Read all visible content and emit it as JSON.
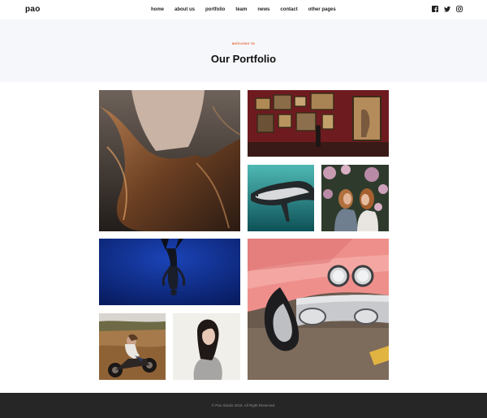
{
  "brand": {
    "logo": "pao"
  },
  "nav": {
    "items": [
      {
        "label": "home"
      },
      {
        "label": "about us"
      },
      {
        "label": "portfolio"
      },
      {
        "label": "team"
      },
      {
        "label": "news"
      },
      {
        "label": "contact"
      },
      {
        "label": "other pages"
      }
    ]
  },
  "social": {
    "icons": [
      "facebook-icon",
      "twitter-icon",
      "instagram-icon"
    ]
  },
  "hero": {
    "kicker": "welcome to",
    "title": "Our Portfolio",
    "kicker_color": "#e3653a"
  },
  "portfolio": {
    "items": [
      {
        "name": "portfolio-item-hair",
        "subject": "woman with long hair"
      },
      {
        "name": "portfolio-item-gallery",
        "subject": "museum gallery red wall"
      },
      {
        "name": "portfolio-item-seal",
        "subject": "seal underwater"
      },
      {
        "name": "portfolio-item-friends",
        "subject": "two women with flowers"
      },
      {
        "name": "portfolio-item-diver",
        "subject": "free diver blue water"
      },
      {
        "name": "portfolio-item-car",
        "subject": "pink vintage car"
      },
      {
        "name": "portfolio-item-motorcycle",
        "subject": "woman on motorcycle"
      },
      {
        "name": "portfolio-item-portrait",
        "subject": "woman portrait"
      }
    ]
  },
  "footer": {
    "copyright": "© Pao Studio 2018. All Right Reserved."
  }
}
